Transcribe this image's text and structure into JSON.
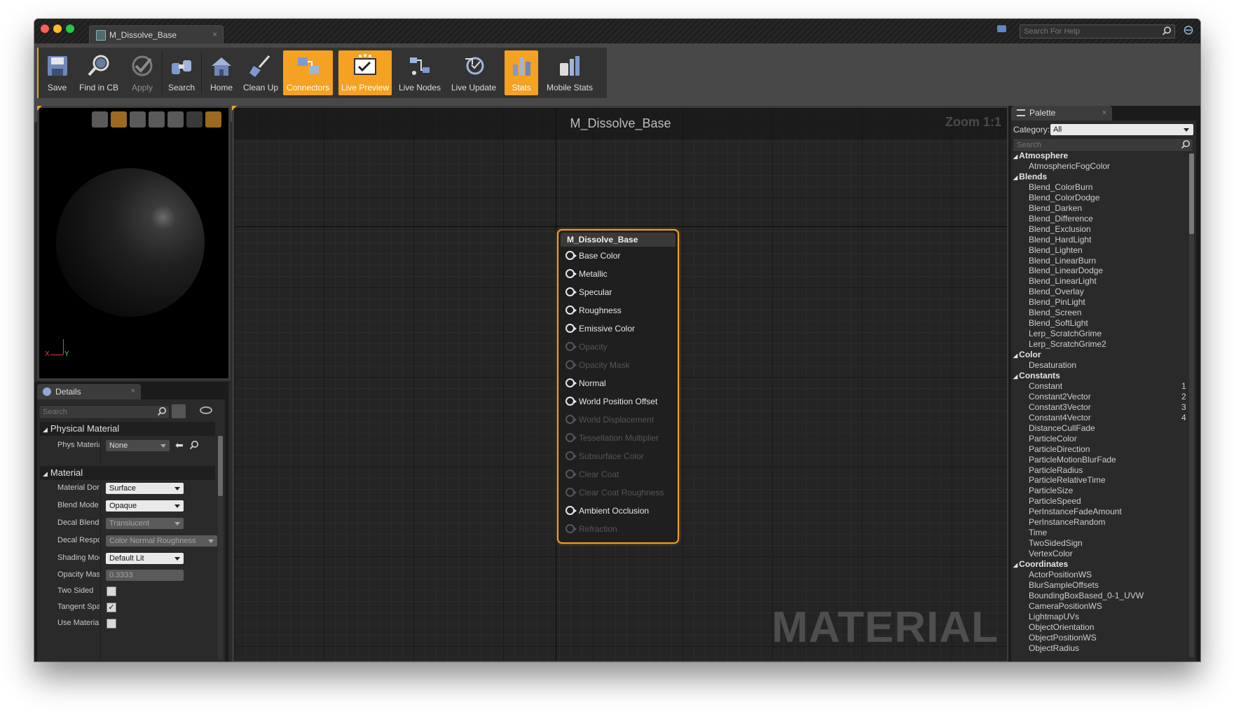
{
  "window": {
    "tab_title": "M_Dissolve_Base",
    "help_search_placeholder": "Search For Help"
  },
  "toolbar": {
    "buttons": [
      {
        "label": "Save",
        "icon": "save-icon",
        "state": "normal"
      },
      {
        "label": "Find in CB",
        "icon": "magnifier-icon",
        "state": "normal"
      },
      {
        "label": "Apply",
        "icon": "checkmark-icon",
        "state": "disabled"
      },
      {
        "label": "Search",
        "icon": "binoculars-icon",
        "state": "normal"
      },
      {
        "label": "Home",
        "icon": "home-icon",
        "state": "normal"
      },
      {
        "label": "Clean Up",
        "icon": "broom-icon",
        "state": "normal"
      },
      {
        "label": "Connectors",
        "icon": "connectors-icon",
        "state": "active"
      },
      {
        "label": "Live Preview",
        "icon": "live-preview-icon",
        "state": "active"
      },
      {
        "label": "Live Nodes",
        "icon": "live-nodes-icon",
        "state": "normal"
      },
      {
        "label": "Live Update",
        "icon": "live-update-icon",
        "state": "normal"
      },
      {
        "label": "Stats",
        "icon": "stats-icon",
        "state": "active"
      },
      {
        "label": "Mobile Stats",
        "icon": "mobile-stats-icon",
        "state": "normal"
      }
    ],
    "active_color": "#f5a122"
  },
  "viewport": {
    "axis_x": "X",
    "axis_y": "Y",
    "z_mark": "Z"
  },
  "details": {
    "tab_label": "Details",
    "search_placeholder": "Search",
    "sections": {
      "physical_material": {
        "title": "Physical Material",
        "phys_material_label": "Phys Material",
        "phys_material_value": "None"
      },
      "material": {
        "title": "Material",
        "domain_label": "Material Domain",
        "domain_value": "Surface",
        "blend_mode_label": "Blend Mode",
        "blend_mode_value": "Opaque",
        "decal_blend_label": "Decal Blend",
        "decal_blend_value": "Translucent",
        "decal_response_label": "Decal Response",
        "decal_response_value": "Color Normal Roughness",
        "shading_model_label": "Shading Model",
        "shading_model_value": "Default Lit",
        "opacity_mask_label": "Opacity Mask",
        "opacity_mask_value": "0.3333",
        "two_sided_label": "Two Sided",
        "tangent_space_label": "Tangent Space",
        "use_material_label": "Use Material",
        "two_sided_checked": false,
        "tangent_space_checked": true,
        "use_material_checked": false
      }
    }
  },
  "graph": {
    "title": "M_Dissolve_Base",
    "zoom": "Zoom 1:1",
    "watermark": "MATERIAL",
    "node": {
      "title": "M_Dissolve_Base",
      "accent": "#f0a022",
      "pins": [
        {
          "label": "Base Color",
          "enabled": true
        },
        {
          "label": "Metallic",
          "enabled": true
        },
        {
          "label": "Specular",
          "enabled": true
        },
        {
          "label": "Roughness",
          "enabled": true
        },
        {
          "label": "Emissive Color",
          "enabled": true
        },
        {
          "label": "Opacity",
          "enabled": false
        },
        {
          "label": "Opacity Mask",
          "enabled": false
        },
        {
          "label": "Normal",
          "enabled": true
        },
        {
          "label": "World Position Offset",
          "enabled": true
        },
        {
          "label": "World Displacement",
          "enabled": false
        },
        {
          "label": "Tessellation Multiplier",
          "enabled": false
        },
        {
          "label": "Subsurface Color",
          "enabled": false
        },
        {
          "label": "Clear Coat",
          "enabled": false
        },
        {
          "label": "Clear Coat Roughness",
          "enabled": false
        },
        {
          "label": "Ambient Occlusion",
          "enabled": true
        },
        {
          "label": "Refraction",
          "enabled": false
        }
      ]
    }
  },
  "palette": {
    "tab_label": "Palette",
    "category_label": "Category:",
    "category_value": "All",
    "search_placeholder": "Search",
    "tree": [
      {
        "type": "header",
        "label": "Atmosphere"
      },
      {
        "type": "item",
        "label": "AtmosphericFogColor"
      },
      {
        "type": "header",
        "label": "Blends"
      },
      {
        "type": "item",
        "label": "Blend_ColorBurn"
      },
      {
        "type": "item",
        "label": "Blend_ColorDodge"
      },
      {
        "type": "item",
        "label": "Blend_Darken"
      },
      {
        "type": "item",
        "label": "Blend_Difference"
      },
      {
        "type": "item",
        "label": "Blend_Exclusion"
      },
      {
        "type": "item",
        "label": "Blend_HardLight"
      },
      {
        "type": "item",
        "label": "Blend_Lighten"
      },
      {
        "type": "item",
        "label": "Blend_LinearBurn"
      },
      {
        "type": "item",
        "label": "Blend_LinearDodge"
      },
      {
        "type": "item",
        "label": "Blend_LinearLight"
      },
      {
        "type": "item",
        "label": "Blend_Overlay"
      },
      {
        "type": "item",
        "label": "Blend_PinLight"
      },
      {
        "type": "item",
        "label": "Blend_Screen"
      },
      {
        "type": "item",
        "label": "Blend_SoftLight"
      },
      {
        "type": "item",
        "label": "Lerp_ScratchGrime"
      },
      {
        "type": "item",
        "label": "Lerp_ScratchGrime2"
      },
      {
        "type": "header",
        "label": "Color"
      },
      {
        "type": "item",
        "label": "Desaturation"
      },
      {
        "type": "header",
        "label": "Constants"
      },
      {
        "type": "item",
        "label": "Constant",
        "shortcut": "1"
      },
      {
        "type": "item",
        "label": "Constant2Vector",
        "shortcut": "2"
      },
      {
        "type": "item",
        "label": "Constant3Vector",
        "shortcut": "3"
      },
      {
        "type": "item",
        "label": "Constant4Vector",
        "shortcut": "4"
      },
      {
        "type": "item",
        "label": "DistanceCullFade"
      },
      {
        "type": "item",
        "label": "ParticleColor"
      },
      {
        "type": "item",
        "label": "ParticleDirection"
      },
      {
        "type": "item",
        "label": "ParticleMotionBlurFade"
      },
      {
        "type": "item",
        "label": "ParticleRadius"
      },
      {
        "type": "item",
        "label": "ParticleRelativeTime"
      },
      {
        "type": "item",
        "label": "ParticleSize"
      },
      {
        "type": "item",
        "label": "ParticleSpeed"
      },
      {
        "type": "item",
        "label": "PerInstanceFadeAmount"
      },
      {
        "type": "item",
        "label": "PerInstanceRandom"
      },
      {
        "type": "item",
        "label": "Time"
      },
      {
        "type": "item",
        "label": "TwoSidedSign"
      },
      {
        "type": "item",
        "label": "VertexColor"
      },
      {
        "type": "header",
        "label": "Coordinates"
      },
      {
        "type": "item",
        "label": "ActorPositionWS"
      },
      {
        "type": "item",
        "label": "BlurSampleOffsets"
      },
      {
        "type": "item",
        "label": "BoundingBoxBased_0-1_UVW"
      },
      {
        "type": "item",
        "label": "CameraPositionWS"
      },
      {
        "type": "item",
        "label": "LightmapUVs"
      },
      {
        "type": "item",
        "label": "ObjectOrientation"
      },
      {
        "type": "item",
        "label": "ObjectPositionWS"
      },
      {
        "type": "item",
        "label": "ObjectRadius"
      }
    ]
  }
}
